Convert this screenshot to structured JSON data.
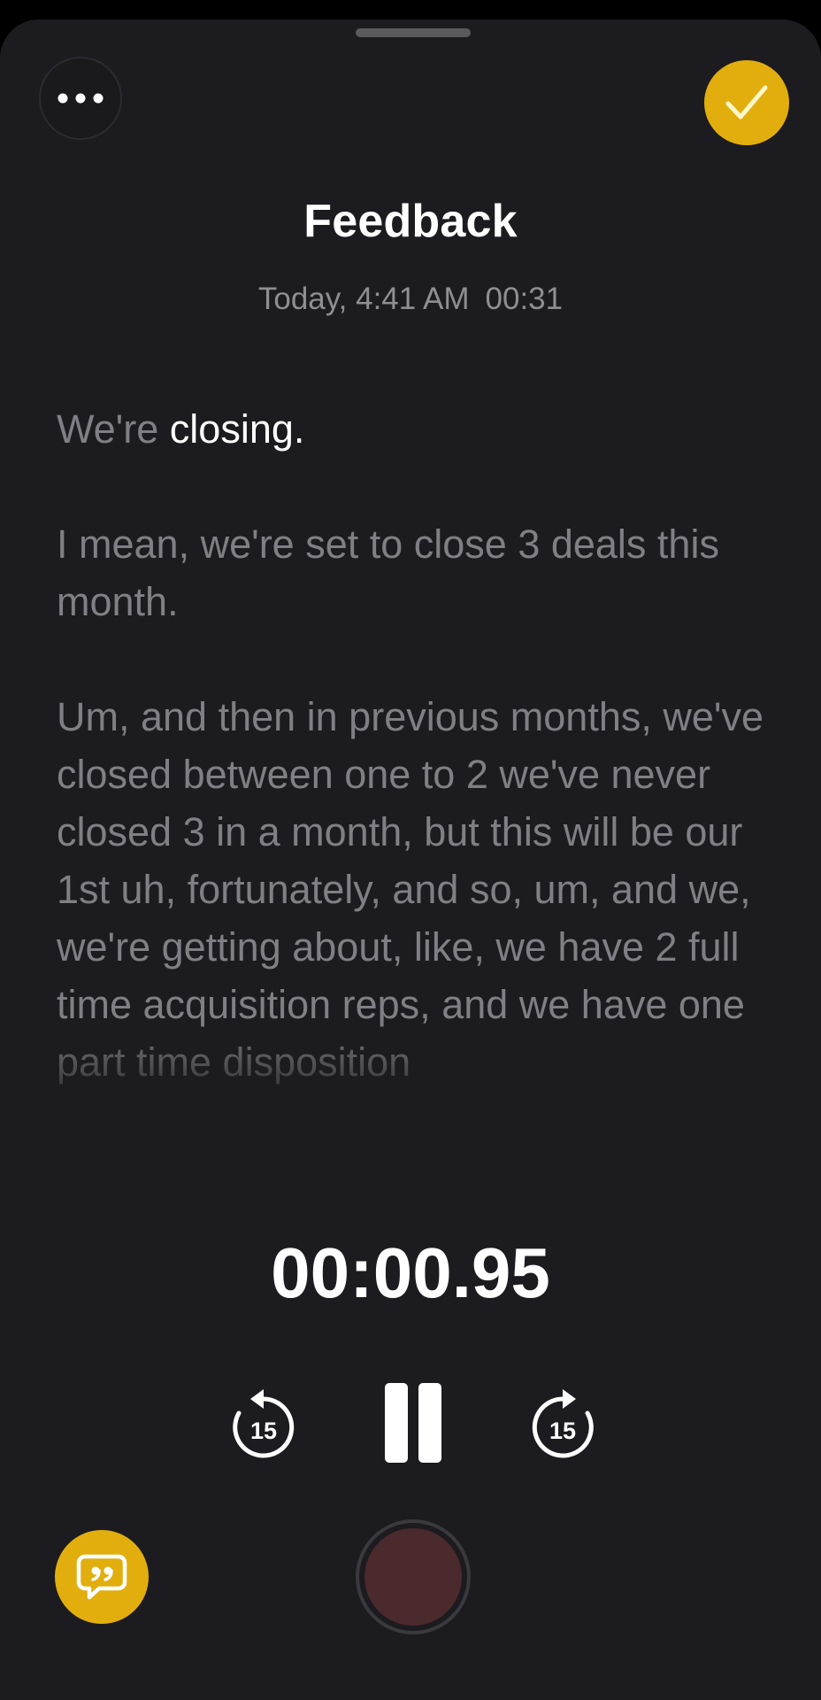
{
  "recording": {
    "title": "Feedback",
    "date": "Today, 4:41 AM",
    "duration": "00:31"
  },
  "transcript": {
    "p1_plain": "We're ",
    "p1_highlight": "closing.",
    "p2": "I mean, we're set to close 3 deals this month.",
    "p3": "Um, and then in previous months, we've closed between one to 2 we've never closed 3 in a month, but this will be our 1st uh, fortunately, and so, um, and we, we're getting about, like, we have 2 full time acquisition reps, and we have one part time disposition"
  },
  "playback": {
    "elapsed": "00:00.95",
    "skip_back_seconds": "15",
    "skip_forward_seconds": "15"
  },
  "colors": {
    "accent": "#e1ae0e",
    "background": "#1c1b1f",
    "text_dim": "#807f85",
    "record": "#4a2a2c"
  },
  "icons": {
    "more": "more-icon",
    "done": "checkmark-icon",
    "skip_back": "skip-back-15-icon",
    "pause": "pause-icon",
    "skip_forward": "skip-forward-15-icon",
    "transcript": "quote-bubble-icon",
    "record": "record-icon"
  }
}
